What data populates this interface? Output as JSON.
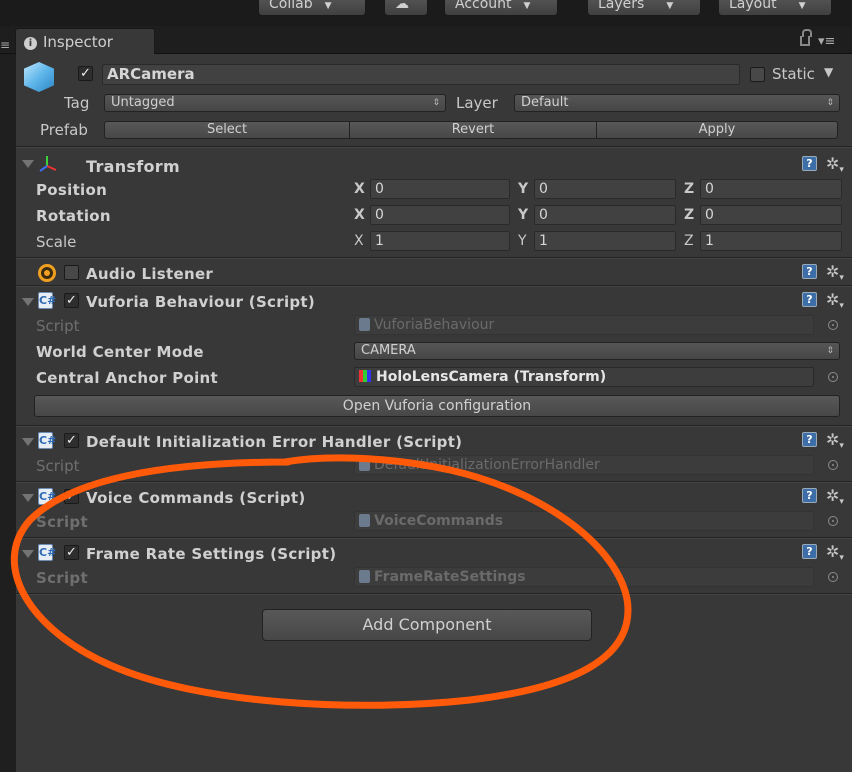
{
  "toolbar": {
    "collab": "Collab",
    "account": "Account",
    "layers": "Layers",
    "layout": "Layout"
  },
  "inspector_tab": {
    "label": "Inspector"
  },
  "gameobject": {
    "name": "ARCamera",
    "static_label": "Static",
    "tag_label": "Tag",
    "tag_value": "Untagged",
    "layer_label": "Layer",
    "layer_value": "Default",
    "prefab_label": "Prefab",
    "prefab_buttons": [
      "Select",
      "Revert",
      "Apply"
    ]
  },
  "transform": {
    "title": "Transform",
    "rows": [
      {
        "label": "Position",
        "x": "0",
        "y": "0",
        "z": "0"
      },
      {
        "label": "Rotation",
        "x": "0",
        "y": "0",
        "z": "0"
      },
      {
        "label": "Scale",
        "x": "1",
        "y": "1",
        "z": "1"
      }
    ],
    "axis_labels": [
      "X",
      "Y",
      "Z"
    ]
  },
  "audio_listener": {
    "title": "Audio Listener"
  },
  "vuforia": {
    "title": "Vuforia Behaviour (Script)",
    "script_label": "Script",
    "script_value": "VuforiaBehaviour",
    "world_center_label": "World Center Mode",
    "world_center_value": "CAMERA",
    "anchor_label": "Central Anchor Point",
    "anchor_value": "HoloLensCamera (Transform)",
    "open_config_button": "Open Vuforia configuration"
  },
  "error_handler": {
    "title": "Default Initialization Error Handler (Script)",
    "script_label": "Script",
    "script_value": "DefaultInitializationErrorHandler"
  },
  "voice_commands": {
    "title": "Voice Commands (Script)",
    "script_label": "Script",
    "script_value": "VoiceCommands"
  },
  "frame_rate": {
    "title": "Frame Rate Settings (Script)",
    "script_label": "Script",
    "script_value": "FrameRateSettings"
  },
  "add_component_button": "Add Component",
  "colors": {
    "panel_bg": "#383838",
    "highlight_stroke": "#ff5a0a",
    "help_icon": "#3e6ea8",
    "audio_icon": "#f0a020"
  }
}
